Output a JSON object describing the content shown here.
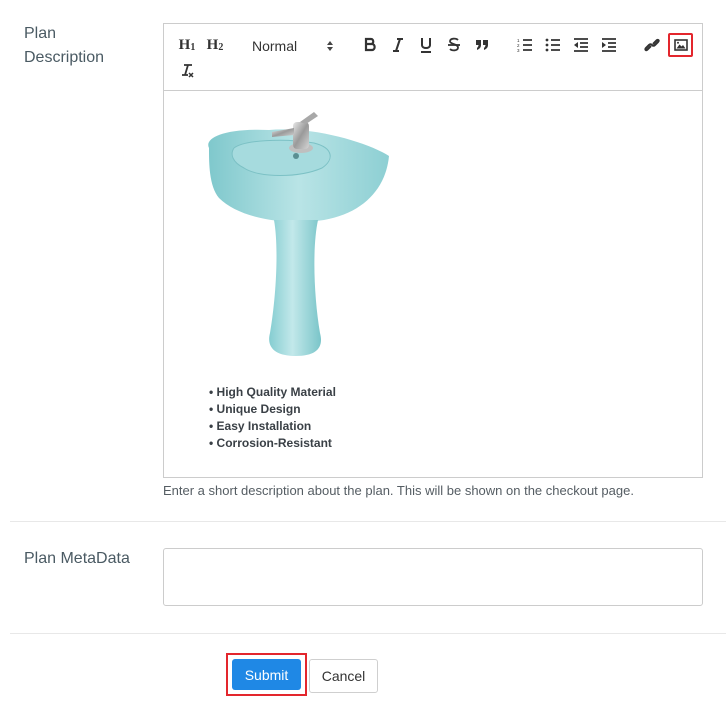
{
  "plan_description": {
    "label": "Plan Description",
    "editor": {
      "toolbar": {
        "h1_label": "H",
        "h1_sub": "1",
        "h2_label": "H",
        "h2_sub": "2",
        "format_select_value": "Normal",
        "icons": [
          "bold-icon",
          "italic-icon",
          "underline-icon",
          "strikethrough-icon",
          "blockquote-icon",
          "ordered-list-icon",
          "bullet-list-icon",
          "outdent-icon",
          "indent-icon",
          "link-icon",
          "image-icon",
          "clear-format-icon"
        ]
      },
      "content": {
        "image": "pedestal-sink",
        "features": [
          "High Quality Material",
          "Unique Design",
          "Easy Installation",
          "Corrosion-Resistant"
        ]
      }
    },
    "help_text": "Enter a short description about the plan. This will be shown on the checkout page."
  },
  "plan_metadata": {
    "label": "Plan MetaData",
    "value": ""
  },
  "actions": {
    "submit_label": "Submit",
    "cancel_label": "Cancel"
  },
  "colors": {
    "primary": "#1f88e5",
    "highlight": "#e3262d",
    "border": "#cccccc"
  }
}
